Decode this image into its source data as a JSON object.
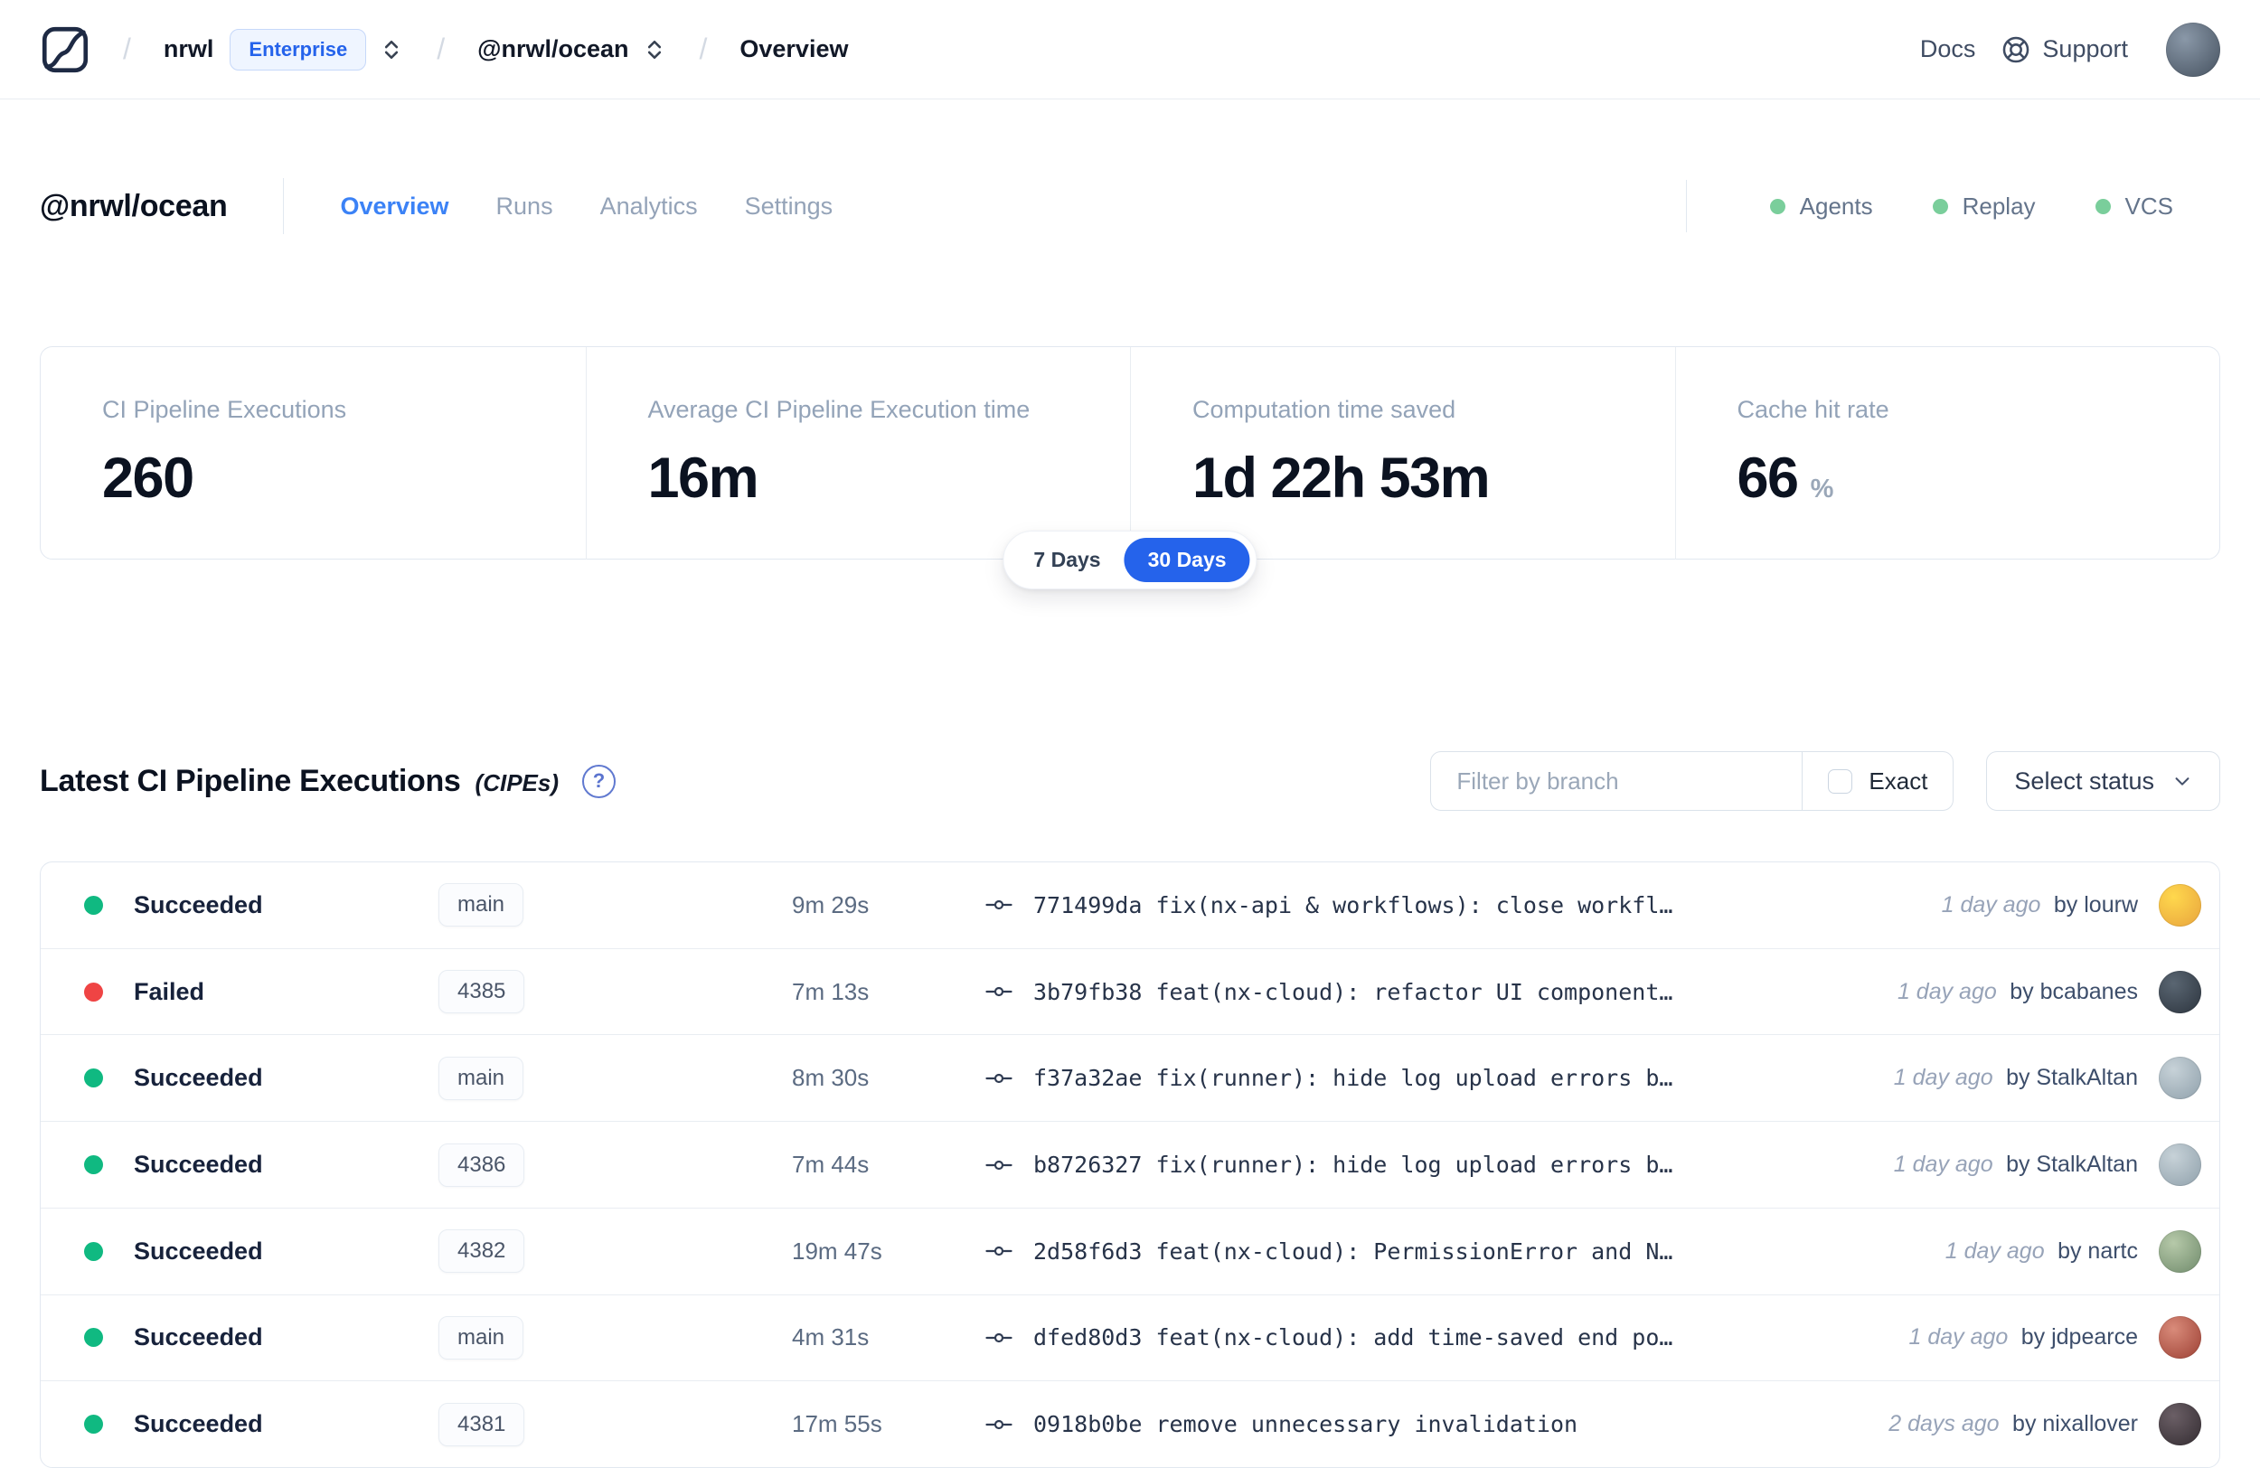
{
  "colors": {
    "accent_blue": "#2563eb",
    "tab_active_blue": "#3b82f6",
    "success_green": "#10b981",
    "failed_red": "#ef4444",
    "indicator_green": "#7ace9b"
  },
  "navbar": {
    "breadcrumb": {
      "separator": "/",
      "org": "nrwl",
      "org_badge": "Enterprise",
      "workspace": "@nrwl/ocean",
      "page": "Overview"
    },
    "docs_label": "Docs",
    "support_label": "Support",
    "avatar_colors": [
      "#8a98a8",
      "#45515f"
    ]
  },
  "workspace_header": {
    "title": "@nrwl/ocean",
    "tabs": [
      {
        "label": "Overview",
        "active": true
      },
      {
        "label": "Runs",
        "active": false
      },
      {
        "label": "Analytics",
        "active": false
      },
      {
        "label": "Settings",
        "active": false
      }
    ],
    "indicators": [
      {
        "label": "Agents"
      },
      {
        "label": "Replay"
      },
      {
        "label": "VCS"
      }
    ]
  },
  "stats": {
    "cards": [
      {
        "label": "CI Pipeline Executions",
        "value": "260"
      },
      {
        "label": "Average CI Pipeline Execution time",
        "value": "16m"
      },
      {
        "label": "Computation time saved",
        "value": "1d 22h 53m"
      },
      {
        "label": "Cache hit rate",
        "value": "66",
        "unit": "%"
      }
    ],
    "range_toggle": {
      "options": [
        "7 Days",
        "30 Days"
      ],
      "selected": "30 Days"
    }
  },
  "cipe_section": {
    "title": "Latest CI Pipeline Executions",
    "subtitle": "(CIPEs)",
    "help_glyph": "?",
    "filter_placeholder": "Filter by branch",
    "exact_label": "Exact",
    "status_select_label": "Select status",
    "rows": [
      {
        "status": "Succeeded",
        "status_color": "#10b981",
        "branch": "main",
        "duration": "9m 29s",
        "commit_hash": "771499da",
        "commit_message": "fix(nx-api & workflows): close workfl…",
        "time": "1 day ago",
        "author": "by lourw",
        "avatar_colors": [
          "#ffd84d",
          "#e8a33d"
        ]
      },
      {
        "status": "Failed",
        "status_color": "#ef4444",
        "branch": "4385",
        "duration": "7m 13s",
        "commit_hash": "3b79fb38",
        "commit_message": "feat(nx-cloud): refactor UI component…",
        "time": "1 day ago",
        "author": "by bcabanes",
        "avatar_colors": [
          "#5a6672",
          "#2c343e"
        ]
      },
      {
        "status": "Succeeded",
        "status_color": "#10b981",
        "branch": "main",
        "duration": "8m 30s",
        "commit_hash": "f37a32ae",
        "commit_message": "fix(runner): hide log upload errors b…",
        "time": "1 day ago",
        "author": "by StalkAltan",
        "avatar_colors": [
          "#c7d2d8",
          "#8fa0ab"
        ]
      },
      {
        "status": "Succeeded",
        "status_color": "#10b981",
        "branch": "4386",
        "duration": "7m 44s",
        "commit_hash": "b8726327",
        "commit_message": "fix(runner): hide log upload errors b…",
        "time": "1 day ago",
        "author": "by StalkAltan",
        "avatar_colors": [
          "#c7d2d8",
          "#8fa0ab"
        ]
      },
      {
        "status": "Succeeded",
        "status_color": "#10b981",
        "branch": "4382",
        "duration": "19m 47s",
        "commit_hash": "2d58f6d3",
        "commit_message": "feat(nx-cloud): PermissionError and N…",
        "time": "1 day ago",
        "author": "by nartc",
        "avatar_colors": [
          "#b6c9a9",
          "#6f8a6b"
        ]
      },
      {
        "status": "Succeeded",
        "status_color": "#10b981",
        "branch": "main",
        "duration": "4m 31s",
        "commit_hash": "dfed80d3",
        "commit_message": "feat(nx-cloud): add time-saved end po…",
        "time": "1 day ago",
        "author": "by jdpearce",
        "avatar_colors": [
          "#d98b7a",
          "#9c3f33"
        ]
      },
      {
        "status": "Succeeded",
        "status_color": "#10b981",
        "branch": "4381",
        "duration": "17m 55s",
        "commit_hash": "0918b0be",
        "commit_message": "remove unnecessary invalidation",
        "time": "2 days ago",
        "author": "by nixallover",
        "avatar_colors": [
          "#6b5f66",
          "#332c31"
        ]
      }
    ]
  }
}
